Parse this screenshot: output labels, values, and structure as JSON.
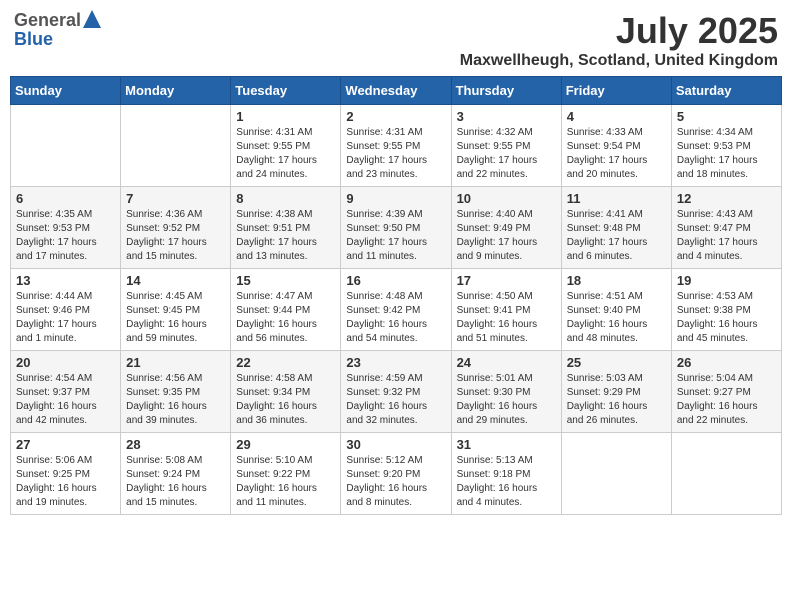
{
  "header": {
    "logo_general": "General",
    "logo_blue": "Blue",
    "month_year": "July 2025",
    "location": "Maxwellheugh, Scotland, United Kingdom"
  },
  "weekdays": [
    "Sunday",
    "Monday",
    "Tuesday",
    "Wednesday",
    "Thursday",
    "Friday",
    "Saturday"
  ],
  "weeks": [
    [
      {
        "day": "",
        "sunrise": "",
        "sunset": "",
        "daylight": ""
      },
      {
        "day": "",
        "sunrise": "",
        "sunset": "",
        "daylight": ""
      },
      {
        "day": "1",
        "sunrise": "Sunrise: 4:31 AM",
        "sunset": "Sunset: 9:55 PM",
        "daylight": "Daylight: 17 hours and 24 minutes."
      },
      {
        "day": "2",
        "sunrise": "Sunrise: 4:31 AM",
        "sunset": "Sunset: 9:55 PM",
        "daylight": "Daylight: 17 hours and 23 minutes."
      },
      {
        "day": "3",
        "sunrise": "Sunrise: 4:32 AM",
        "sunset": "Sunset: 9:55 PM",
        "daylight": "Daylight: 17 hours and 22 minutes."
      },
      {
        "day": "4",
        "sunrise": "Sunrise: 4:33 AM",
        "sunset": "Sunset: 9:54 PM",
        "daylight": "Daylight: 17 hours and 20 minutes."
      },
      {
        "day": "5",
        "sunrise": "Sunrise: 4:34 AM",
        "sunset": "Sunset: 9:53 PM",
        "daylight": "Daylight: 17 hours and 18 minutes."
      }
    ],
    [
      {
        "day": "6",
        "sunrise": "Sunrise: 4:35 AM",
        "sunset": "Sunset: 9:53 PM",
        "daylight": "Daylight: 17 hours and 17 minutes."
      },
      {
        "day": "7",
        "sunrise": "Sunrise: 4:36 AM",
        "sunset": "Sunset: 9:52 PM",
        "daylight": "Daylight: 17 hours and 15 minutes."
      },
      {
        "day": "8",
        "sunrise": "Sunrise: 4:38 AM",
        "sunset": "Sunset: 9:51 PM",
        "daylight": "Daylight: 17 hours and 13 minutes."
      },
      {
        "day": "9",
        "sunrise": "Sunrise: 4:39 AM",
        "sunset": "Sunset: 9:50 PM",
        "daylight": "Daylight: 17 hours and 11 minutes."
      },
      {
        "day": "10",
        "sunrise": "Sunrise: 4:40 AM",
        "sunset": "Sunset: 9:49 PM",
        "daylight": "Daylight: 17 hours and 9 minutes."
      },
      {
        "day": "11",
        "sunrise": "Sunrise: 4:41 AM",
        "sunset": "Sunset: 9:48 PM",
        "daylight": "Daylight: 17 hours and 6 minutes."
      },
      {
        "day": "12",
        "sunrise": "Sunrise: 4:43 AM",
        "sunset": "Sunset: 9:47 PM",
        "daylight": "Daylight: 17 hours and 4 minutes."
      }
    ],
    [
      {
        "day": "13",
        "sunrise": "Sunrise: 4:44 AM",
        "sunset": "Sunset: 9:46 PM",
        "daylight": "Daylight: 17 hours and 1 minute."
      },
      {
        "day": "14",
        "sunrise": "Sunrise: 4:45 AM",
        "sunset": "Sunset: 9:45 PM",
        "daylight": "Daylight: 16 hours and 59 minutes."
      },
      {
        "day": "15",
        "sunrise": "Sunrise: 4:47 AM",
        "sunset": "Sunset: 9:44 PM",
        "daylight": "Daylight: 16 hours and 56 minutes."
      },
      {
        "day": "16",
        "sunrise": "Sunrise: 4:48 AM",
        "sunset": "Sunset: 9:42 PM",
        "daylight": "Daylight: 16 hours and 54 minutes."
      },
      {
        "day": "17",
        "sunrise": "Sunrise: 4:50 AM",
        "sunset": "Sunset: 9:41 PM",
        "daylight": "Daylight: 16 hours and 51 minutes."
      },
      {
        "day": "18",
        "sunrise": "Sunrise: 4:51 AM",
        "sunset": "Sunset: 9:40 PM",
        "daylight": "Daylight: 16 hours and 48 minutes."
      },
      {
        "day": "19",
        "sunrise": "Sunrise: 4:53 AM",
        "sunset": "Sunset: 9:38 PM",
        "daylight": "Daylight: 16 hours and 45 minutes."
      }
    ],
    [
      {
        "day": "20",
        "sunrise": "Sunrise: 4:54 AM",
        "sunset": "Sunset: 9:37 PM",
        "daylight": "Daylight: 16 hours and 42 minutes."
      },
      {
        "day": "21",
        "sunrise": "Sunrise: 4:56 AM",
        "sunset": "Sunset: 9:35 PM",
        "daylight": "Daylight: 16 hours and 39 minutes."
      },
      {
        "day": "22",
        "sunrise": "Sunrise: 4:58 AM",
        "sunset": "Sunset: 9:34 PM",
        "daylight": "Daylight: 16 hours and 36 minutes."
      },
      {
        "day": "23",
        "sunrise": "Sunrise: 4:59 AM",
        "sunset": "Sunset: 9:32 PM",
        "daylight": "Daylight: 16 hours and 32 minutes."
      },
      {
        "day": "24",
        "sunrise": "Sunrise: 5:01 AM",
        "sunset": "Sunset: 9:30 PM",
        "daylight": "Daylight: 16 hours and 29 minutes."
      },
      {
        "day": "25",
        "sunrise": "Sunrise: 5:03 AM",
        "sunset": "Sunset: 9:29 PM",
        "daylight": "Daylight: 16 hours and 26 minutes."
      },
      {
        "day": "26",
        "sunrise": "Sunrise: 5:04 AM",
        "sunset": "Sunset: 9:27 PM",
        "daylight": "Daylight: 16 hours and 22 minutes."
      }
    ],
    [
      {
        "day": "27",
        "sunrise": "Sunrise: 5:06 AM",
        "sunset": "Sunset: 9:25 PM",
        "daylight": "Daylight: 16 hours and 19 minutes."
      },
      {
        "day": "28",
        "sunrise": "Sunrise: 5:08 AM",
        "sunset": "Sunset: 9:24 PM",
        "daylight": "Daylight: 16 hours and 15 minutes."
      },
      {
        "day": "29",
        "sunrise": "Sunrise: 5:10 AM",
        "sunset": "Sunset: 9:22 PM",
        "daylight": "Daylight: 16 hours and 11 minutes."
      },
      {
        "day": "30",
        "sunrise": "Sunrise: 5:12 AM",
        "sunset": "Sunset: 9:20 PM",
        "daylight": "Daylight: 16 hours and 8 minutes."
      },
      {
        "day": "31",
        "sunrise": "Sunrise: 5:13 AM",
        "sunset": "Sunset: 9:18 PM",
        "daylight": "Daylight: 16 hours and 4 minutes."
      },
      {
        "day": "",
        "sunrise": "",
        "sunset": "",
        "daylight": ""
      },
      {
        "day": "",
        "sunrise": "",
        "sunset": "",
        "daylight": ""
      }
    ]
  ]
}
